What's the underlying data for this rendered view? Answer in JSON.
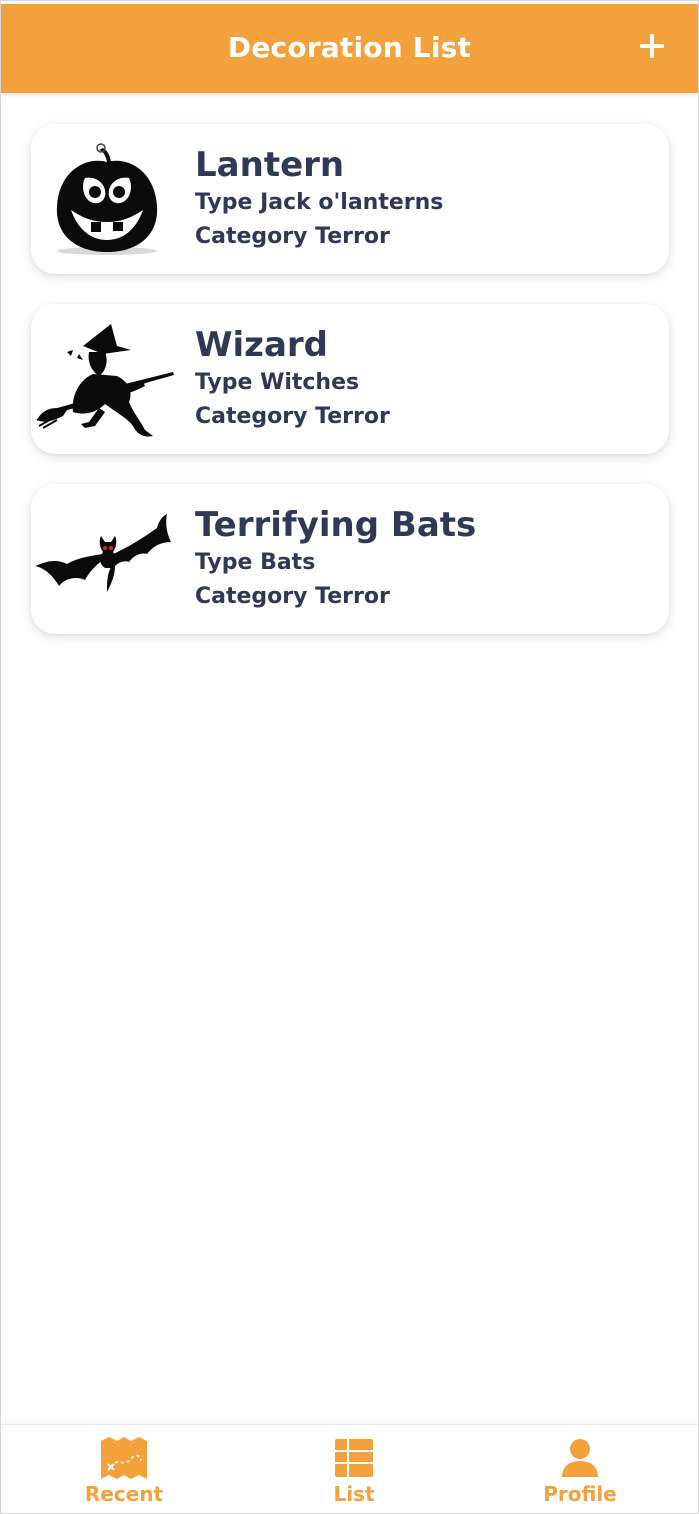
{
  "header": {
    "title": "Decoration List",
    "add_icon": "plus-icon"
  },
  "decorations": [
    {
      "title": "Lantern",
      "type_line": "Type Jack o'lanterns",
      "category_line": "Category Terror",
      "image": "jack-o-lantern-image"
    },
    {
      "title": "Wizard",
      "type_line": "Type Witches",
      "category_line": "Category Terror",
      "image": "witch-on-broom-image"
    },
    {
      "title": "Terrifying Bats",
      "type_line": "Type Bats",
      "category_line": "Category Terror",
      "image": "bat-image"
    }
  ],
  "bottom_nav": {
    "items": [
      {
        "label": "Recent",
        "icon": "treasure-map-icon"
      },
      {
        "label": "List",
        "icon": "list-grid-icon"
      },
      {
        "label": "Profile",
        "icon": "user-icon"
      }
    ]
  },
  "colors": {
    "accent": "#f3a13c",
    "text": "#2e3a55",
    "background": "#ffffff"
  }
}
